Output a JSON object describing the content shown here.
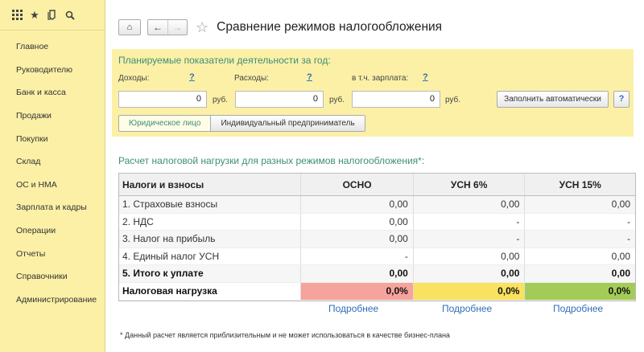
{
  "sidebar": {
    "tools": [
      "grid-icon",
      "star-icon",
      "history-icon",
      "search-icon"
    ],
    "items": [
      {
        "label": "Главное"
      },
      {
        "label": "Руководителю"
      },
      {
        "label": "Банк и касса"
      },
      {
        "label": "Продажи"
      },
      {
        "label": "Покупки"
      },
      {
        "label": "Склад"
      },
      {
        "label": "ОС и НМА"
      },
      {
        "label": "Зарплата и кадры"
      },
      {
        "label": "Операции"
      },
      {
        "label": "Отчеты"
      },
      {
        "label": "Справочники"
      },
      {
        "label": "Администрирование"
      }
    ]
  },
  "page": {
    "title": "Сравнение режимов налогообложения"
  },
  "plan": {
    "title": "Планируемые показатели деятельности за год:",
    "income_label": "Доходы:",
    "expense_label": "Расходы:",
    "salary_label": "в т.ч. зарплата:",
    "help_mark": "?",
    "income_value": "0",
    "expense_value": "0",
    "salary_value": "0",
    "currency": "руб.",
    "fill_button": "Заполнить автоматически",
    "help_button": "?",
    "entity_options": [
      "Юридическое лицо",
      "Индивидуальный предприниматель"
    ],
    "entity_selected": "Юридическое лицо"
  },
  "calc": {
    "title": "Расчет налоговой нагрузки для разных режимов налогообложения*:",
    "headers": [
      "Налоги и взносы",
      "ОСНО",
      "УСН 6%",
      "УСН 15%"
    ],
    "rows": [
      {
        "name": "1. Страховые взносы",
        "osno": "0,00",
        "usn6": "0,00",
        "usn15": "0,00"
      },
      {
        "name": "2. НДС",
        "osno": "0,00",
        "usn6": "-",
        "usn15": "-"
      },
      {
        "name": "3. Налог на прибыль",
        "osno": "0,00",
        "usn6": "-",
        "usn15": "-"
      },
      {
        "name": "4. Единый налог УСН",
        "osno": "-",
        "usn6": "0,00",
        "usn15": "0,00"
      }
    ],
    "total": {
      "name": "5. Итого к уплате",
      "osno": "0,00",
      "usn6": "0,00",
      "usn15": "0,00"
    },
    "load": {
      "name": "Налоговая нагрузка",
      "osno": "0,0%",
      "usn6": "0,0%",
      "usn15": "0,0%"
    },
    "load_colors": {
      "osno": "#f6a39c",
      "usn6": "#f8e25f",
      "usn15": "#a3cc57"
    },
    "more_link": "Подробнее"
  },
  "footnote": "* Данный расчет является приблизительным и не может использоваться в качестве бизнес-плана"
}
